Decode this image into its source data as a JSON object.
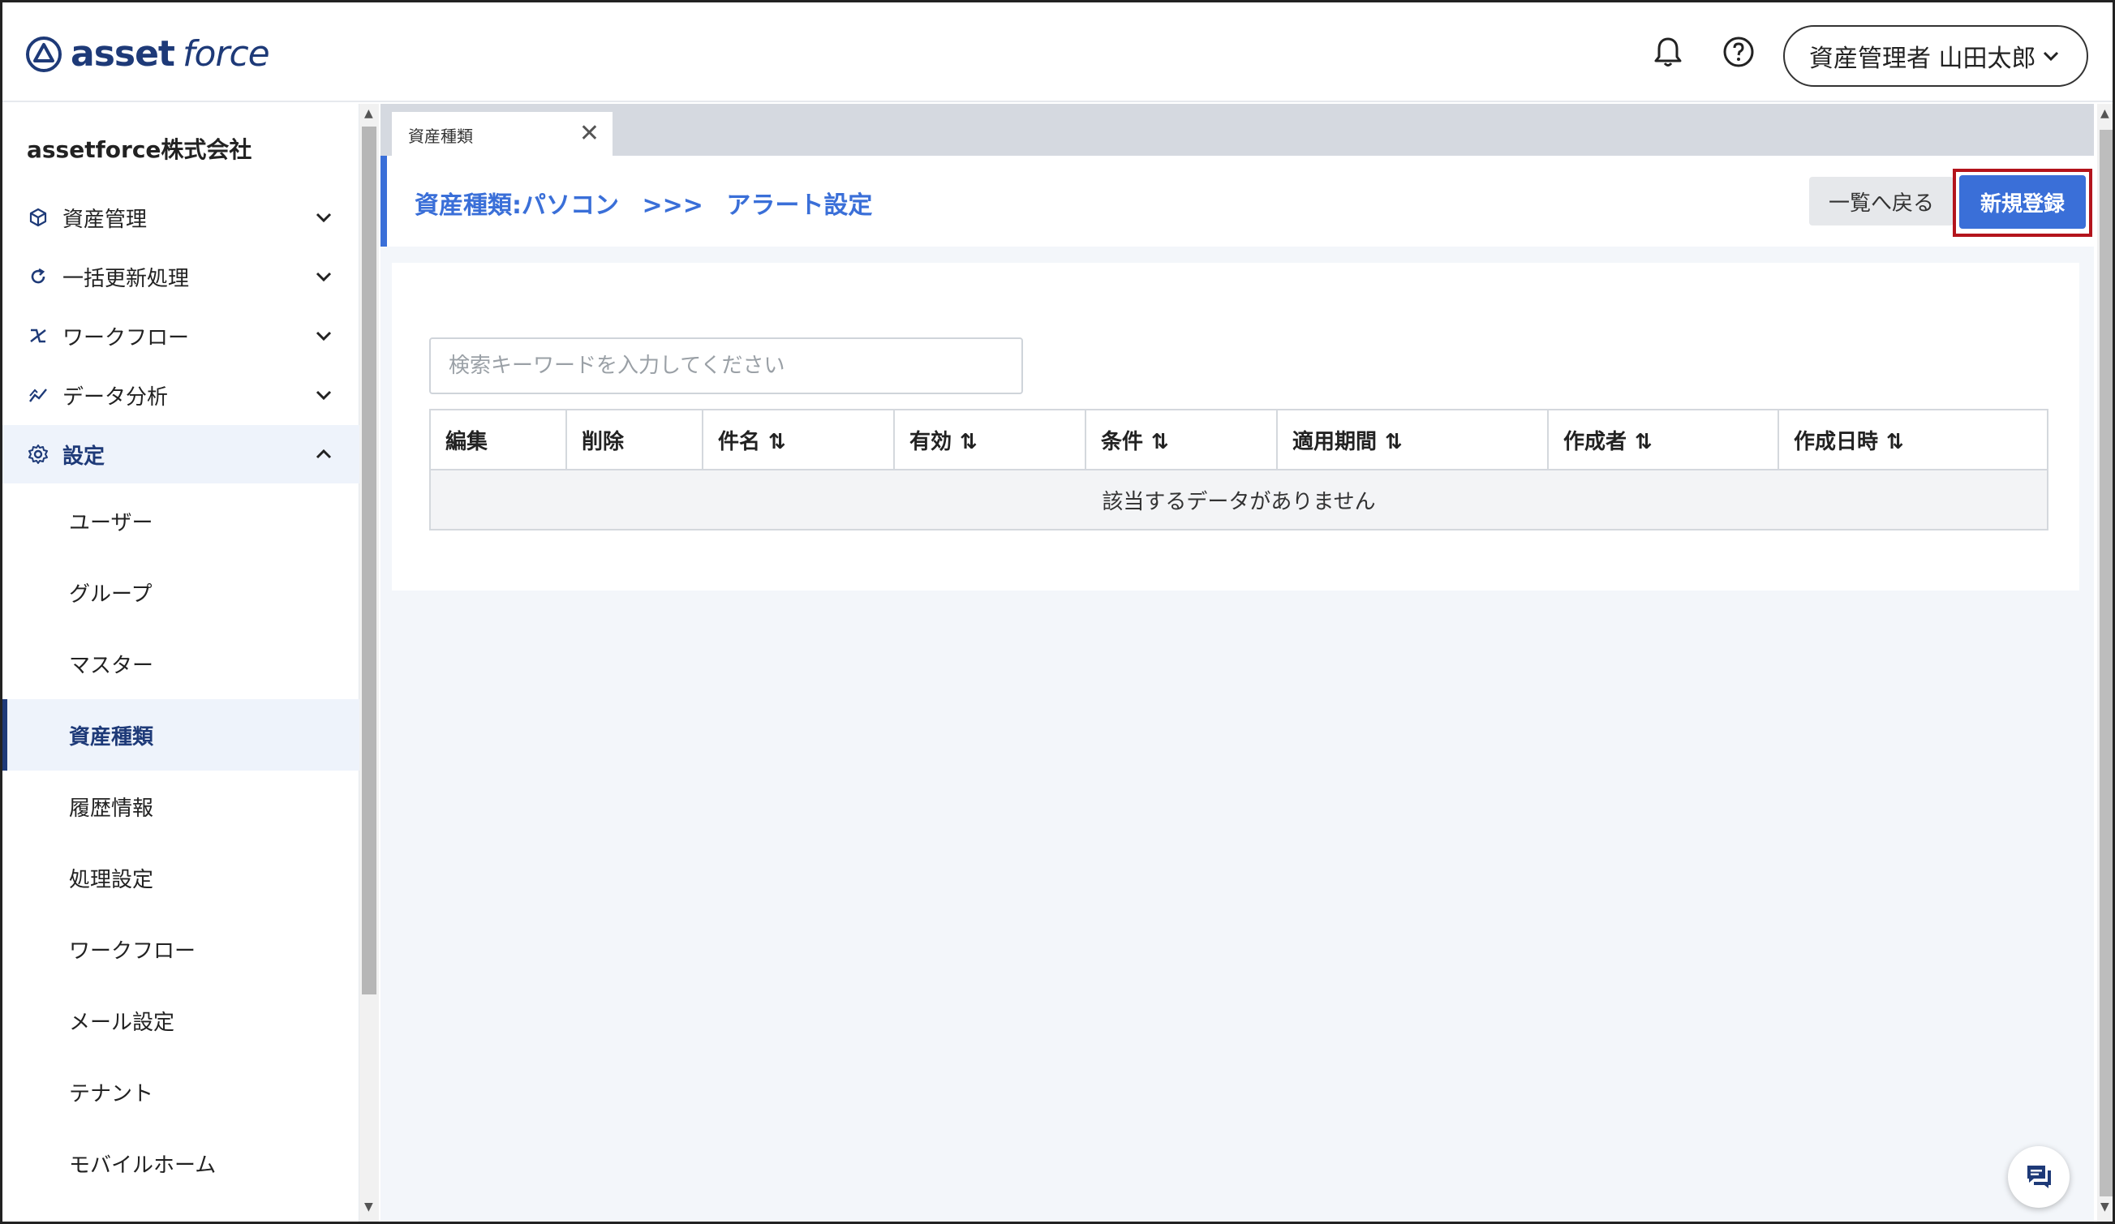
{
  "header": {
    "logo_asset": "asset",
    "logo_force": "force",
    "user_menu_label": "資産管理者 山田太郎"
  },
  "sidebar": {
    "company": "assetforce株式会社",
    "items": [
      {
        "label": "資産管理",
        "icon": "cube-icon"
      },
      {
        "label": "一括更新処理",
        "icon": "refresh-icon"
      },
      {
        "label": "ワークフロー",
        "icon": "workflow-icon"
      },
      {
        "label": "データ分析",
        "icon": "chart-icon"
      },
      {
        "label": "設定",
        "icon": "gear-icon"
      }
    ],
    "settings_sub": [
      {
        "label": "ユーザー"
      },
      {
        "label": "グループ"
      },
      {
        "label": "マスター"
      },
      {
        "label": "資産種類"
      },
      {
        "label": "履歴情報"
      },
      {
        "label": "処理設定"
      },
      {
        "label": "ワークフロー"
      },
      {
        "label": "メール設定"
      },
      {
        "label": "テナント"
      },
      {
        "label": "モバイルホーム"
      }
    ]
  },
  "main": {
    "tab_label": "資産種類",
    "breadcrumb": {
      "part1": "資産種類:パソコン",
      "separator": ">>>",
      "part2": "アラート設定"
    },
    "back_button": "一覧へ戻る",
    "new_button": "新規登録",
    "search_placeholder": "検索キーワードを入力してください",
    "table": {
      "headers": [
        "編集",
        "削除",
        "件名",
        "有効",
        "条件",
        "適用期間",
        "作成者",
        "作成日時"
      ],
      "empty_message": "該当するデータがありません"
    }
  },
  "colors": {
    "accent": "#3a6fd8",
    "brand": "#1e3a78",
    "highlight_outline": "#b3141c"
  }
}
